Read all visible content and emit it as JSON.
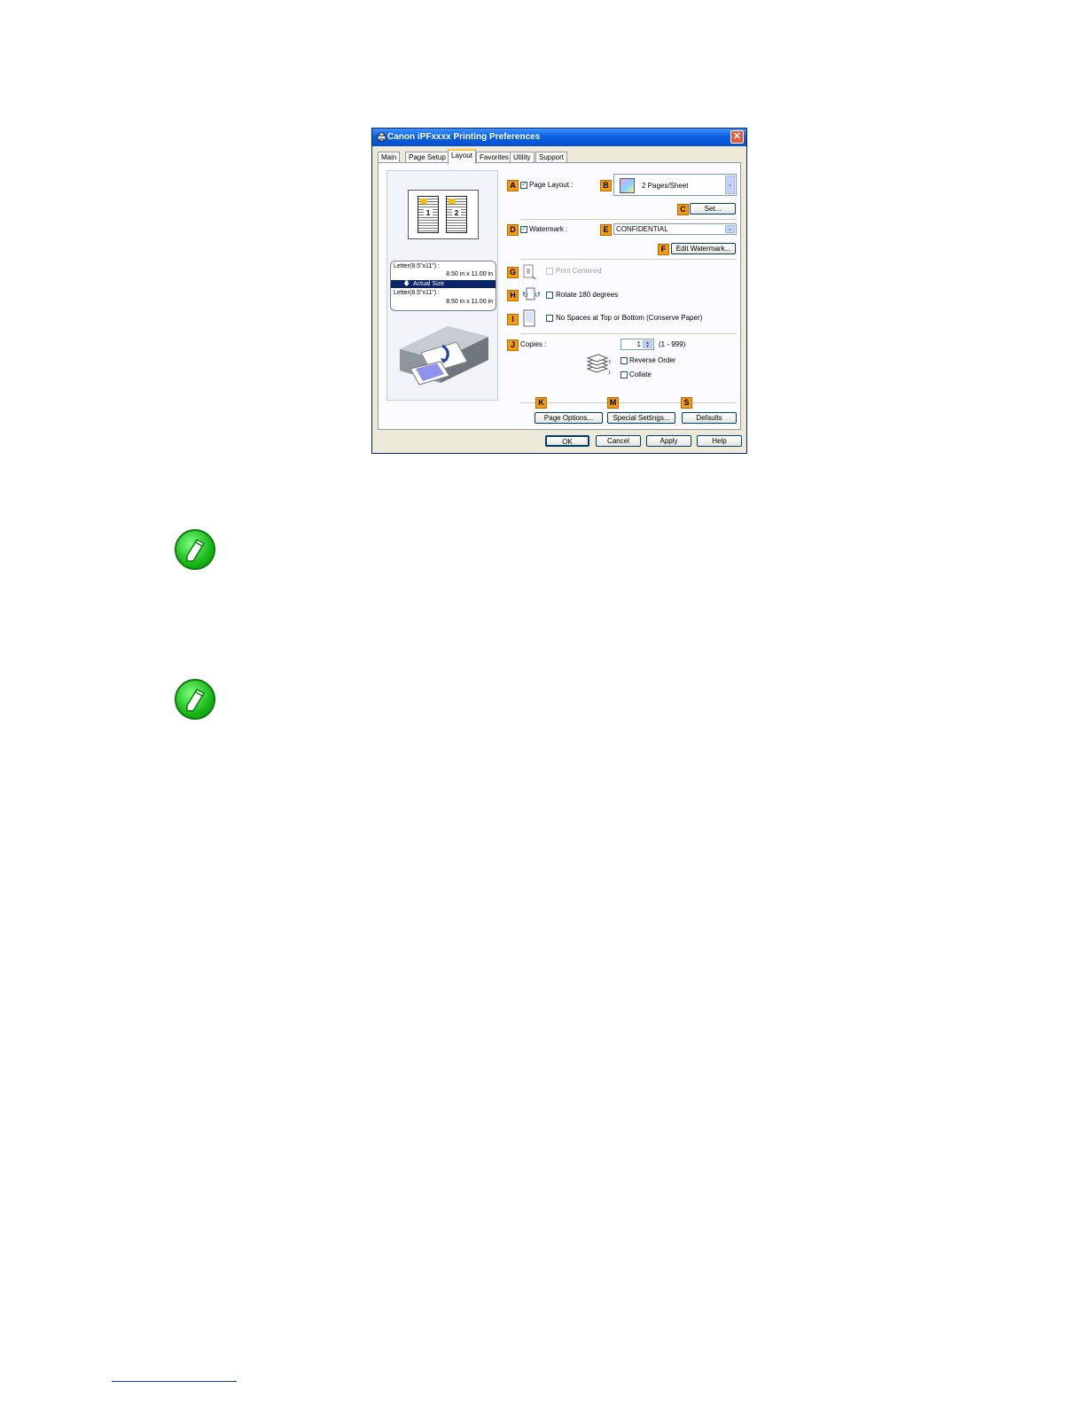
{
  "window": {
    "title": "Canon iPFxxxx Printing Preferences",
    "close": "✕"
  },
  "tabs": [
    "Main",
    "Page Setup",
    "Layout",
    "Favorites",
    "Utility",
    "Support"
  ],
  "active_tab": "Layout",
  "preview": {
    "page_numbers": [
      "1",
      "2"
    ],
    "info_line1": "Letter(8.5\"x11\") :",
    "info_size1": "8.50 in x 11.00 in",
    "info_selected": "Actual Size",
    "info_line3": "Letter(8.5\"x11\") :",
    "info_size2": "8.50 in x 11.00 in"
  },
  "letters": {
    "A": "A",
    "B": "B",
    "C": "C",
    "D": "D",
    "E": "E",
    "F": "F",
    "G": "G",
    "H": "H",
    "I": "I",
    "J": "J",
    "K": "K",
    "M": "M",
    "S": "S"
  },
  "page_layout": {
    "label": "Page Layout :",
    "checked": true,
    "value": "2 Pages/Sheet",
    "set_button": "Set..."
  },
  "watermark": {
    "label": "Watermark :",
    "checked": true,
    "value": "CONFIDENTIAL",
    "edit_button": "Edit Watermark..."
  },
  "print_centered": {
    "label": "Print Centered",
    "checked": false,
    "enabled": false
  },
  "rotate": {
    "label": "Rotate 180 degrees",
    "checked": false
  },
  "no_spaces": {
    "label": "No Spaces at Top or Bottom (Conserve Paper)",
    "checked": false
  },
  "copies": {
    "label": "Copies :",
    "value": "1",
    "range": "(1 - 999)",
    "reverse_order": "Reverse Order",
    "collate": "Collate"
  },
  "bottom_buttons": {
    "page_options": "Page Options...",
    "special_settings": "Special Settings...",
    "defaults": "Defaults"
  },
  "dialog_buttons": {
    "ok": "OK",
    "cancel": "Cancel",
    "apply": "Apply",
    "help": "Help"
  },
  "icons": [
    "printer-icon",
    "close-icon",
    "note-pencil-icon"
  ]
}
